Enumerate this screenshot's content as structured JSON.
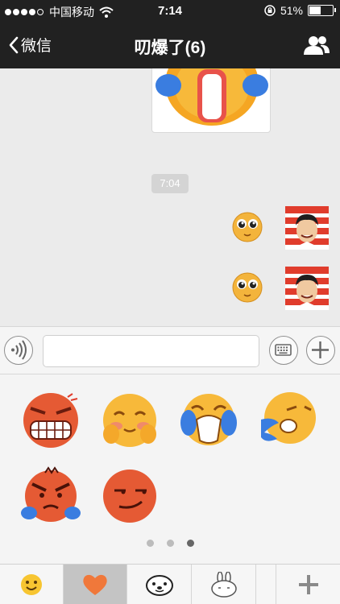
{
  "status_bar": {
    "carrier": "中国移动",
    "time": "7:14",
    "battery_percent": "51%",
    "battery_level": 0.51,
    "signal_dots_filled": 4,
    "signal_dots_total": 5
  },
  "nav": {
    "back_label": "微信",
    "title": "叨爆了(6)",
    "members_icon": "people-icon"
  },
  "chat": {
    "timestamp": "7:04",
    "messages": [
      {
        "type": "image",
        "content": "crying-emoji-sticker"
      },
      {
        "type": "emoji",
        "content": "pleading-face",
        "sender": "me"
      },
      {
        "type": "emoji",
        "content": "pleading-face",
        "sender": "me"
      }
    ]
  },
  "input_bar": {
    "voice_icon": "voice-icon",
    "input_value": "",
    "keyboard_icon": "keyboard-icon",
    "plus_icon": "plus-icon"
  },
  "emoji_panel": {
    "emojis": [
      "angry-grin",
      "shy-blush",
      "crying",
      "sneezing",
      "furious",
      "smirk"
    ],
    "page_count": 3,
    "active_page": 3
  },
  "tabs": {
    "items": [
      "smiley-tab",
      "heart-tab",
      "seal-tab",
      "bunny-tab",
      "",
      "add-tab"
    ],
    "selected": "heart-tab"
  },
  "colors": {
    "bar_bg": "#212121",
    "chat_bg": "#ebebeb",
    "panel_bg": "#f4f4f4",
    "heart": "#f0783a",
    "emoji_yellow": "#f7b93a",
    "emoji_red": "#e55a34",
    "cry_blue": "#3a7de0"
  }
}
